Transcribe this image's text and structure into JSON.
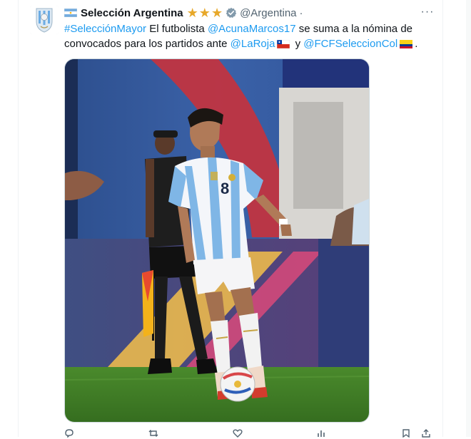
{
  "tweet": {
    "author": {
      "display_name": "Selección Argentina",
      "handle": "@Argentina",
      "separator": "·",
      "badges": [
        "star-icon",
        "star-icon",
        "star-icon",
        "verified-badge-icon"
      ],
      "avatar_icon": "afa-crest-icon",
      "flag_icon": "argentina-flag-icon"
    },
    "text": {
      "hashtag": "#SelecciónMayor",
      "part1": " El futbolista ",
      "mention_player": "@AcunaMarcos17",
      "part2": " se suma a la nómina de convocados para los partidos ante ",
      "mention_chile": "@LaRoja",
      "chile_flag": "chile-flag-icon",
      "part3": " y ",
      "mention_colombia": "@FCFSeleccionCol",
      "colombia_flag": "colombia-flag-icon",
      "part4": "."
    },
    "media": {
      "shirt_number": "8"
    },
    "more_label": "···",
    "actions": [
      {
        "icon": "reply-icon"
      },
      {
        "icon": "retweet-icon"
      },
      {
        "icon": "like-icon"
      },
      {
        "icon": "views-icon"
      },
      {
        "icon": "bookmark-icon"
      },
      {
        "icon": "share-icon"
      }
    ]
  },
  "colors": {
    "link": "#1d9bf0",
    "secondary_text": "#536471",
    "star": "#e7a82a",
    "verified": "#829aab"
  }
}
